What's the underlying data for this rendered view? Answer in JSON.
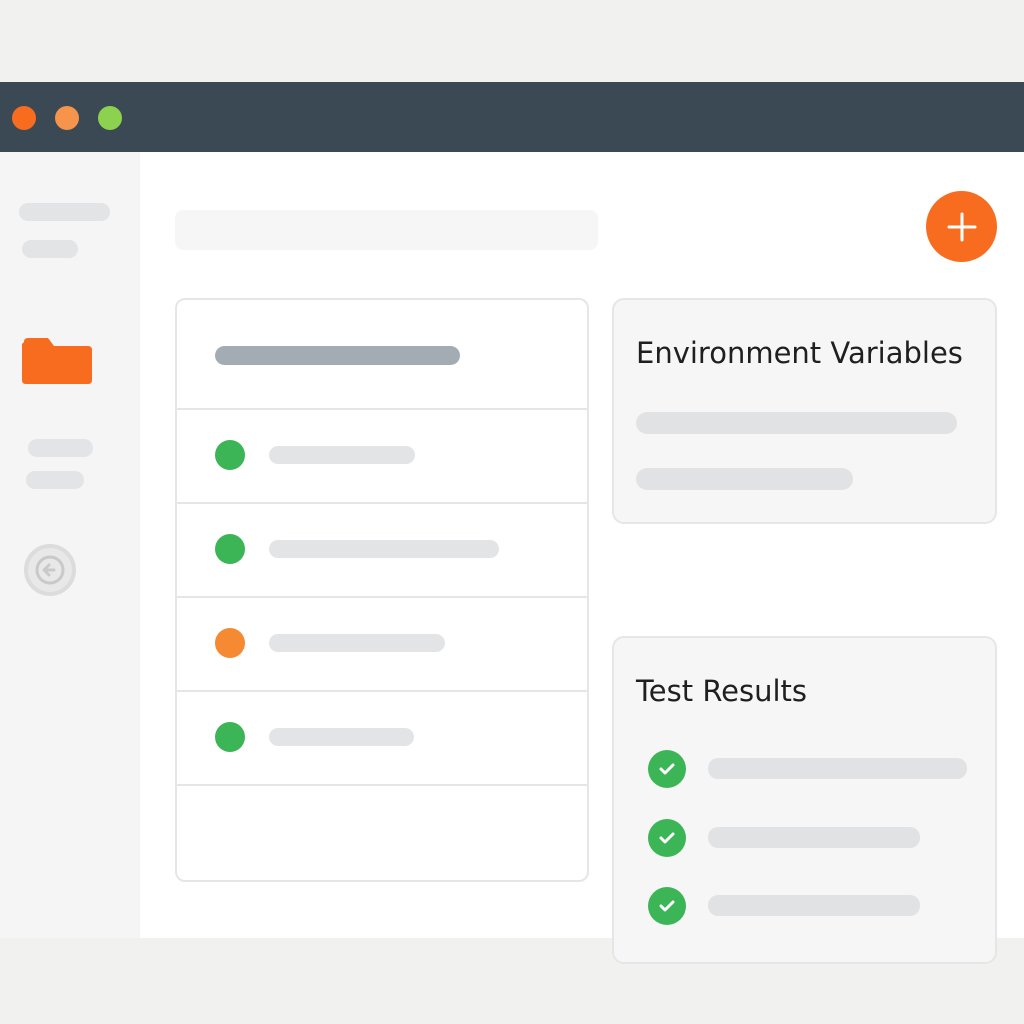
{
  "colors": {
    "titlebar": "#3a4954",
    "window_close": "#f86c1f",
    "window_minimize": "#f5944a",
    "window_maximize": "#8dd24e",
    "accent": "#f86c1f",
    "status_ok": "#3bb556",
    "status_warn": "#f58a33"
  },
  "icons": {
    "sidebar_folder": "folder-icon",
    "sidebar_back": "back-arrow-icon",
    "add": "plus-icon",
    "test_pass": "check-icon"
  },
  "list": {
    "rows": [
      {
        "status": "ok"
      },
      {
        "status": "ok"
      },
      {
        "status": "warn"
      },
      {
        "status": "ok"
      }
    ]
  },
  "env_panel": {
    "title": "Environment Variables"
  },
  "tests_panel": {
    "title": "Test Results",
    "results": [
      {
        "status": "pass"
      },
      {
        "status": "pass"
      },
      {
        "status": "pass"
      }
    ]
  }
}
